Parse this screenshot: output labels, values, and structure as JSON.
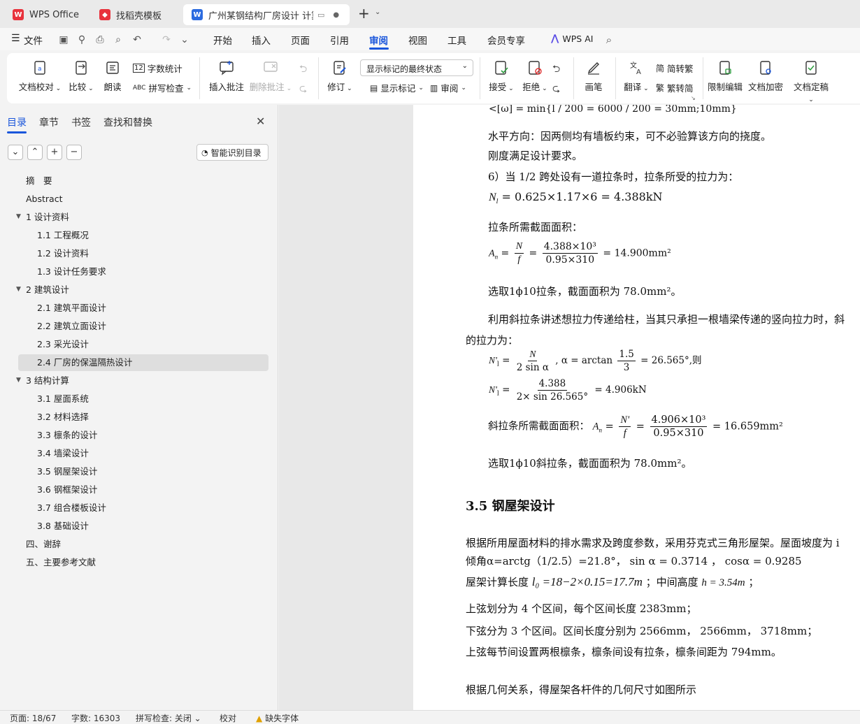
{
  "titlebar": {
    "tabs": [
      {
        "label": "WPS Office",
        "icon": "wps-logo-icon"
      },
      {
        "label": "找稻壳模板",
        "icon": "docer-icon"
      },
      {
        "label": "广州某钢结构厂房设计 计算说",
        "icon": "word-doc-icon"
      }
    ],
    "new_tab": "+"
  },
  "menubar": {
    "file": "文件",
    "items": [
      "开始",
      "插入",
      "页面",
      "引用",
      "审阅",
      "视图",
      "工具",
      "会员专享"
    ],
    "active": "审阅",
    "ai": "WPS AI"
  },
  "ribbon": {
    "doc_check": "文档校对",
    "compare": "比较",
    "read_aloud": "朗读",
    "word_count": "字数统计",
    "spell_check": "拼写检查",
    "insert_comment": "插入批注",
    "delete_comment": "删除批注",
    "revise": "修订",
    "markup_state": "显示标记的最终状态",
    "show_markup": "显示标记",
    "review": "审阅",
    "accept": "接受",
    "reject": "拒绝",
    "pen": "画笔",
    "translate": "翻译",
    "to_traditional": "简转繁",
    "to_simplified": "繁转简",
    "restrict_edit": "限制编辑",
    "encrypt": "文档加密",
    "finalize": "文档定稿"
  },
  "leftpanel": {
    "tabs": [
      "目录",
      "章节",
      "书签",
      "查找和替换"
    ],
    "smart_toc": "智能识别目录",
    "toc": [
      {
        "label": "摘　要",
        "level": 1
      },
      {
        "label": "Abstract",
        "level": 1
      },
      {
        "label": "1 设计资料",
        "level": 1,
        "expand": true
      },
      {
        "label": "1.1 工程概况",
        "level": 2
      },
      {
        "label": "1.2 设计资料",
        "level": 2
      },
      {
        "label": "1.3 设计任务要求",
        "level": 2
      },
      {
        "label": "2 建筑设计",
        "level": 1,
        "expand": true
      },
      {
        "label": "2.1 建筑平面设计",
        "level": 2
      },
      {
        "label": "2.2 建筑立面设计",
        "level": 2
      },
      {
        "label": "2.3  采光设计",
        "level": 2
      },
      {
        "label": "2.4  厂房的保温隔热设计",
        "level": 2,
        "selected": true
      },
      {
        "label": "3 结构计算",
        "level": 1,
        "expand": true
      },
      {
        "label": "3.1 屋面系统",
        "level": 2
      },
      {
        "label": "3.2 材料选择",
        "level": 2
      },
      {
        "label": "3.3 檩条的设计",
        "level": 2
      },
      {
        "label": "3.4  墙梁设计",
        "level": 2
      },
      {
        "label": "3.5  钢屋架设计",
        "level": 2
      },
      {
        "label": "3.6 钢框架设计",
        "level": 2
      },
      {
        "label": "3.7 组合楼板设计",
        "level": 2
      },
      {
        "label": "3.8 基础设计",
        "level": 2
      },
      {
        "label": "四、谢辞",
        "level": 1
      },
      {
        "label": "五、主要参考文献",
        "level": 1
      }
    ]
  },
  "document": {
    "l1": "<[ω] = min{l / 200 = 6000 / 200 = 30mm;10mm}",
    "l2": "水平方向：因两侧均有墙板约束，可不必验算该方向的挠度。",
    "l3": "刚度满足设计要求。",
    "l4": "6）当 1/2 跨处设有一道拉条时，拉条所受的拉力为：",
    "l5": "N",
    "l5b": "l",
    "l5c": " = 0.625×1.17×6 = 4.388kN",
    "l6": "拉条所需截面面积：",
    "l7a": "A",
    "l7sub": "n",
    "l7num1": "N",
    "l7den1": "f",
    "l7num2": "4.388×10³",
    "l7den2": "0.95×310",
    "l7res": "= 14.900mm²",
    "l8": "选取1ϕ10拉条，截面面积为 78.0mm²。",
    "l9": "利用斜拉条讲述想拉力传递给柱，当其只承担一根墙梁传递的竖向拉力时，斜",
    "l10": "的拉力为：",
    "l11a": "N'",
    "l11num": "N",
    "l11den": "2 sin α",
    "l11b": ", α = arctan",
    "l11num2": "1.5",
    "l11den2": "3",
    "l11c": "= 26.565°,则",
    "l12num": "4.388",
    "l12den": "2× sin 26.565°",
    "l12c": "= 4.906kN",
    "l13": "斜拉条所需截面面积：",
    "l13num1": "N'",
    "l13den1": "f",
    "l13num2": "4.906×10³",
    "l13den2": "0.95×310",
    "l13res": "= 16.659mm²",
    "l14": "选取1ϕ10斜拉条，截面面积为 78.0mm²。",
    "h35": "3.5  钢屋架设计",
    "l15": "根据所用屋面材料的排水需求及跨度参数，采用芬克式三角形屋架。屋面坡度为 i",
    "l16": "倾角α=arctg（1/2.5）=21.8°，  sin α = 0.3714 ，  cosα = 0.9285",
    "l17a": "屋架计算长度",
    "l17b": "l₀ =18−2×0.15=17.7m",
    "l17c": "；中间高度",
    "l17d": "h = 3.54m",
    "l17e": "；",
    "l18": "上弦划分为 4 个区间，每个区间长度 2383mm；",
    "l19": "下弦分为 3 个区间。区间长度分别为 2566mm，  2566mm，  3718mm；",
    "l20": "上弦每节间设置两根檩条，檩条间设有拉条，檩条间距为 794mm。",
    "l21": "根据几何关系，得屋架各杆件的几何尺寸如图所示"
  },
  "statusbar": {
    "page": "页面: 18/67",
    "words": "字数: 16303",
    "spell": "拼写检查: 关闭",
    "proof": "校对",
    "missing_font": "缺失字体"
  },
  "colors": {
    "accent": "#1a56db",
    "wps_red": "#e8323c"
  }
}
